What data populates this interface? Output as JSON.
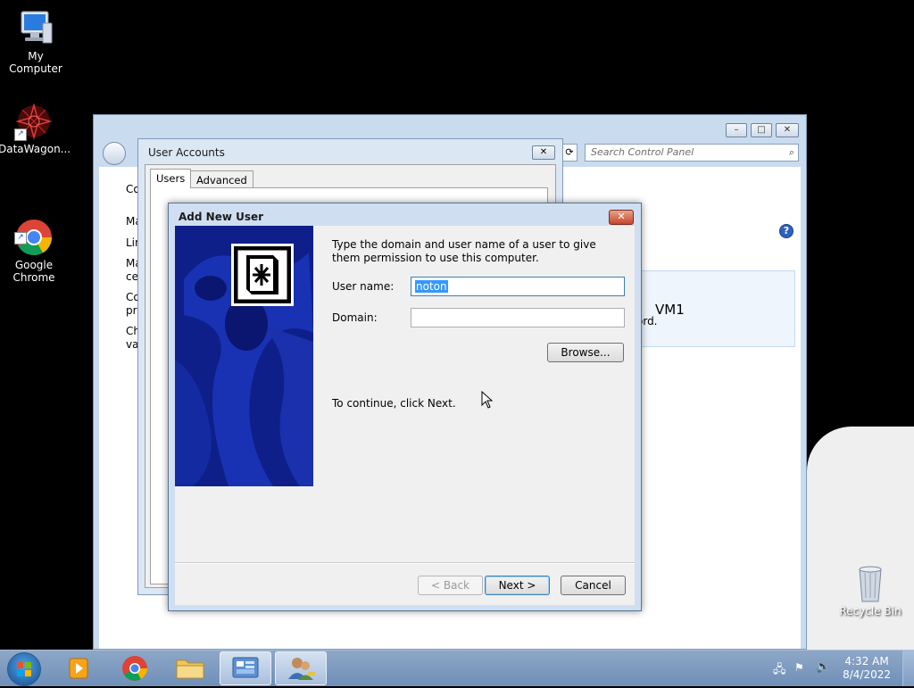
{
  "desktop": {
    "icons": [
      {
        "label": "My Computer",
        "icon": "computer-icon"
      },
      {
        "label": "DataWagon...",
        "icon": "datawagon-icon"
      },
      {
        "label": "Google\nChrome",
        "icon": "chrome-icon"
      },
      {
        "label": "Recycle Bin",
        "icon": "recycle-bin-icon"
      }
    ]
  },
  "control_panel": {
    "search_placeholder": "Search Control Panel",
    "help": "?",
    "vm_name": "VM1",
    "partial_text": "ord.",
    "left_fragments": [
      "Co",
      "Ma",
      "Lir",
      "Ma",
      "ce",
      "Co",
      "pro",
      "Ch",
      "va"
    ]
  },
  "user_accounts": {
    "title": "User Accounts",
    "tabs": [
      "Users",
      "Advanced"
    ],
    "fragment": "U"
  },
  "add_new_user": {
    "title": "Add New User",
    "instruction": "Type the domain and user name of a user to give them permission to use this computer.",
    "username_label": "User name:",
    "username_value": "noton",
    "domain_label": "Domain:",
    "domain_value": "",
    "browse_label": "Browse...",
    "continue_text": "To continue, click Next.",
    "back_label": "< Back",
    "next_label": "Next >",
    "cancel_label": "Cancel"
  },
  "taskbar": {
    "time": "4:32 AM",
    "date": "8/4/2022"
  },
  "colors": {
    "desktop": "#000000",
    "taskbar": "#7a98bf",
    "wizard_banner": "#0e1f8a",
    "close_button": "#c7452b",
    "selection": "#3399ff"
  }
}
